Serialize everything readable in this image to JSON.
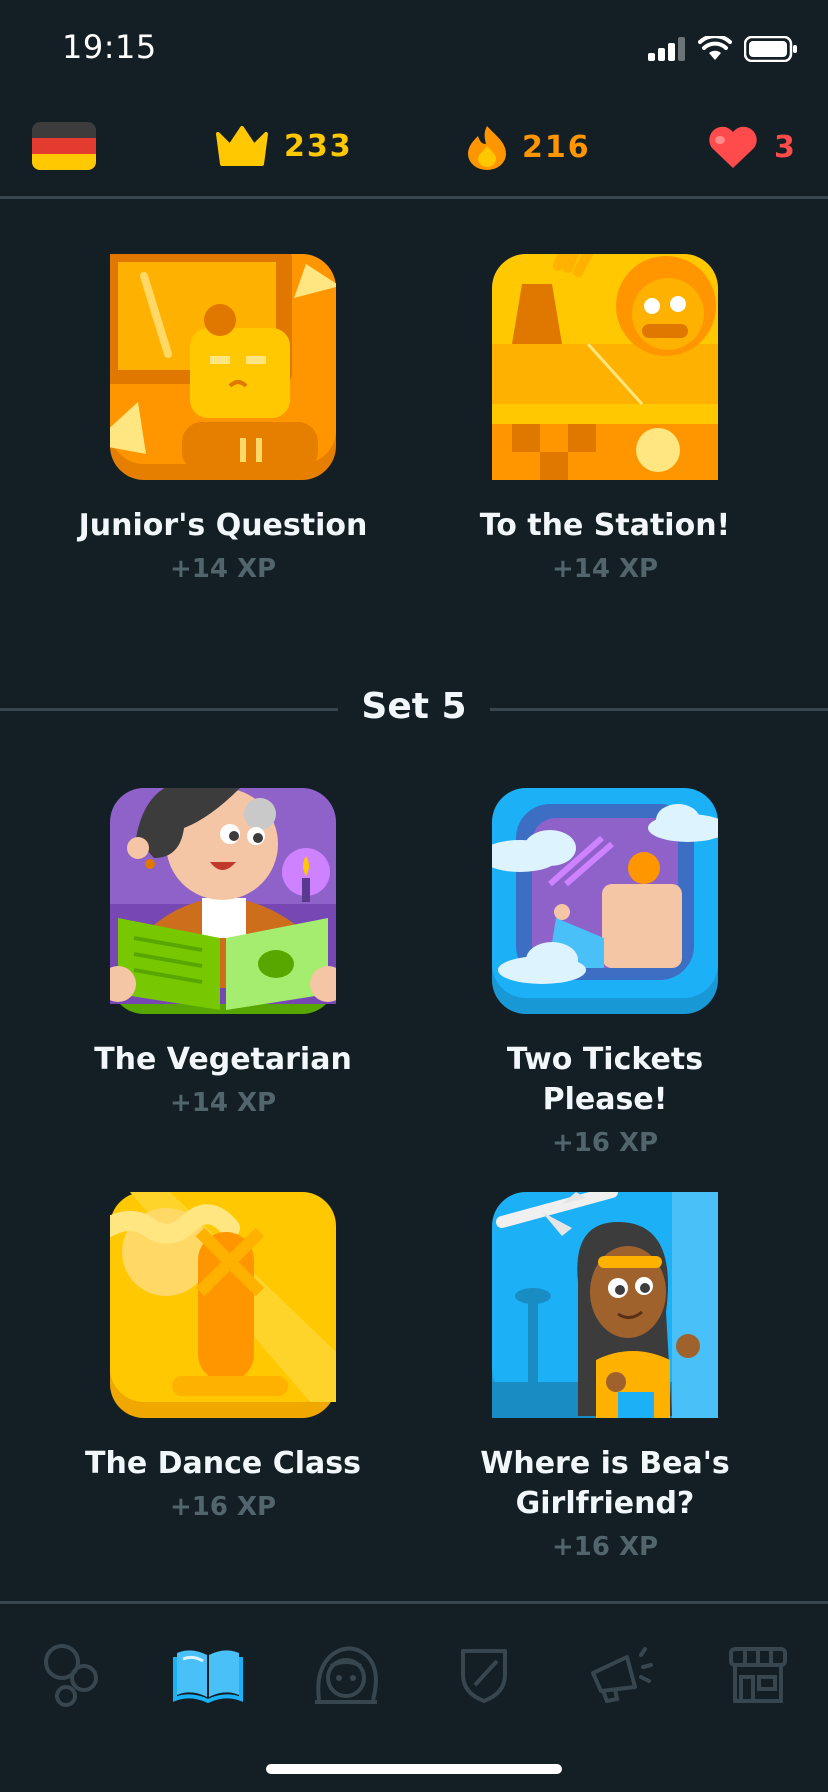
{
  "status_bar": {
    "time": "19:15"
  },
  "stats": {
    "language_flag": "german-flag-icon",
    "crowns": "233",
    "streak": "216",
    "hearts": "3",
    "crown_color": "#ffc800",
    "streak_color": "#ff9600",
    "heart_color": "#ff4b4b"
  },
  "stories_top": [
    {
      "title": "Junior's Question",
      "xp": "+14 XP",
      "icon": "junior-question-art"
    },
    {
      "title": "To the Station!",
      "xp": "+14 XP",
      "icon": "to-the-station-art"
    }
  ],
  "set5": {
    "label": "Set 5",
    "stories": [
      {
        "title": "The Vegetarian",
        "xp": "+14 XP",
        "icon": "vegetarian-art"
      },
      {
        "title": "Two Tickets Please!",
        "xp": "+16 XP",
        "icon": "two-tickets-art"
      },
      {
        "title": "The Dance Class",
        "xp": "+16 XP",
        "icon": "dance-class-art"
      },
      {
        "title_line1": "Where is Bea's",
        "title_line2": "Girlfriend?",
        "xp": "+16 XP",
        "icon": "bea-girlfriend-art"
      }
    ]
  },
  "bottom_nav": [
    {
      "name": "learn-tab",
      "icon": "circles-icon",
      "active": false
    },
    {
      "name": "stories-tab",
      "icon": "book-icon",
      "active": true
    },
    {
      "name": "profile-tab",
      "icon": "avatar-icon",
      "active": false
    },
    {
      "name": "leaderboard-tab",
      "icon": "shield-icon",
      "active": false
    },
    {
      "name": "news-tab",
      "icon": "megaphone-icon",
      "active": false
    },
    {
      "name": "shop-tab",
      "icon": "shop-icon",
      "active": false
    }
  ]
}
